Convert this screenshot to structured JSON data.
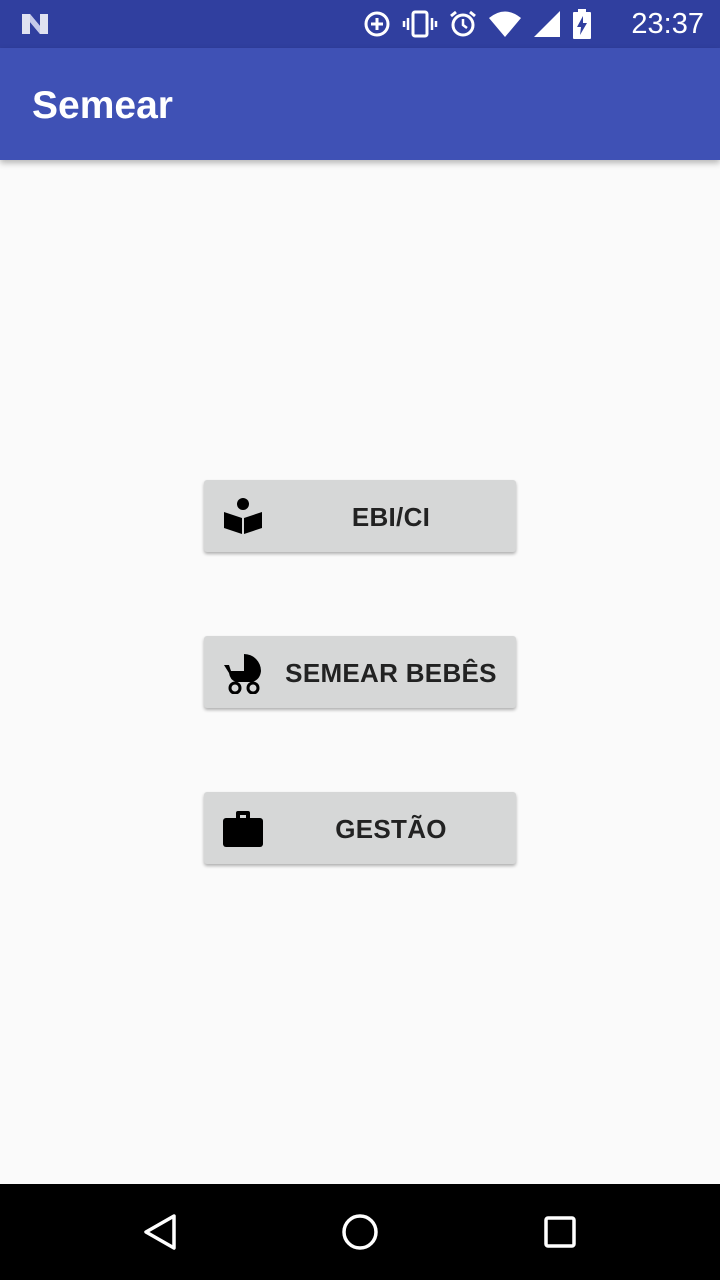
{
  "status_bar": {
    "time": "23:37",
    "icons": [
      "app-logo-icon",
      "data-saver-icon",
      "vibrate-icon",
      "alarm-icon",
      "wifi-icon",
      "signal-icon",
      "battery-charging-icon"
    ]
  },
  "app_bar": {
    "title": "Semear"
  },
  "menu": {
    "buttons": [
      {
        "label": "EBI/CI",
        "icon": "reading-person-icon"
      },
      {
        "label": "SEMEAR BEBÊS",
        "icon": "baby-stroller-icon"
      },
      {
        "label": "GESTÃO",
        "icon": "briefcase-icon"
      }
    ]
  },
  "nav_bar": {
    "buttons": [
      "back-icon",
      "home-icon",
      "recents-icon"
    ]
  },
  "colors": {
    "status_bar": "#303f9f",
    "app_bar": "#3f51b5",
    "background": "#fafafa",
    "button": "#d6d7d7",
    "button_text": "#222222",
    "nav_bar": "#000000"
  }
}
